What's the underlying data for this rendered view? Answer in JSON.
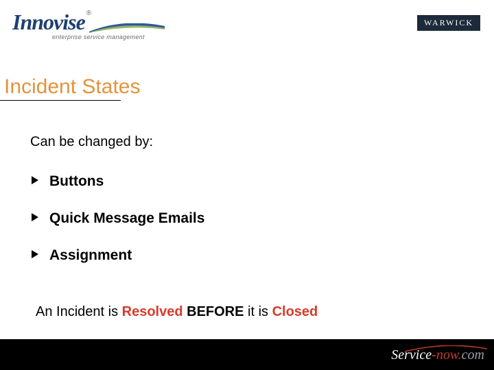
{
  "header": {
    "brand": "Innovise",
    "registered": "®",
    "tagline": "enterprise service management",
    "badge": "WARWICK"
  },
  "title": "Incident States",
  "body": {
    "lead": "Can be changed by:",
    "bullets": [
      "Buttons",
      "Quick Message Emails",
      "Assignment"
    ]
  },
  "footline": {
    "t1": "An Incident is ",
    "resolved": "Resolved",
    "t2": " BEFORE",
    "t3": " it is ",
    "closed": "Closed"
  },
  "footer": {
    "svc": "Servi",
    "c": "c",
    "e": "e",
    "dash": "-",
    "now": "now",
    "dot": ".",
    "com": "com"
  }
}
